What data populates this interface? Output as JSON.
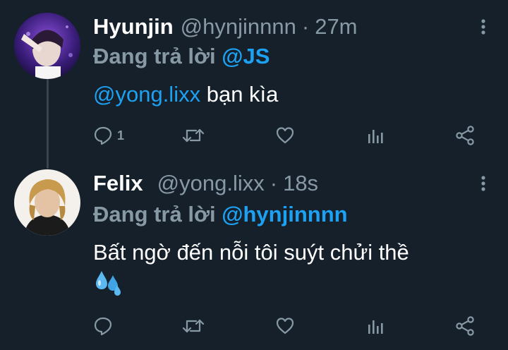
{
  "tweets": [
    {
      "name": "Hyunjin",
      "handle": "@hynjinnnn",
      "separator": "·",
      "time": "27m",
      "replying_prefix": "Đang trả lời",
      "replying_to": "@JS",
      "body_mention": "@yong.lixx",
      "body_text": " bạn kìa",
      "reply_count": "1",
      "avatar_icon": "hyunjin-avatar-photo"
    },
    {
      "name": "Felix",
      "handle": "@yong.lixx",
      "separator": "·",
      "time": "18s",
      "replying_prefix": "Đang trả lời",
      "replying_to": "@hynjinnnn",
      "body_text": "Bất ngờ đến nỗi tôi suýt chửi thề",
      "body_emoji_icon": "sweat-droplets-icon",
      "reply_count": "",
      "avatar_icon": "felix-avatar-photo"
    }
  ],
  "colors": {
    "background": "#15202b",
    "text": "#ffffff",
    "muted": "#8899a6",
    "link": "#1da1f2",
    "thread_line": "#38444d"
  },
  "action_icons": [
    "reply-icon",
    "retweet-icon",
    "like-icon",
    "analytics-icon",
    "share-icon"
  ]
}
